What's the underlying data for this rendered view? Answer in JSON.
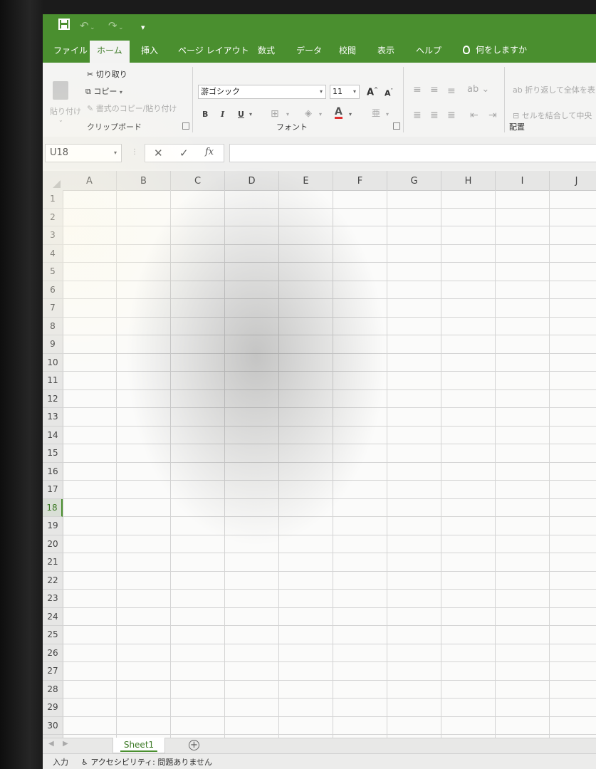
{
  "quick_access": {
    "save_icon": "save-icon",
    "undo_icon": "undo-icon",
    "redo_icon": "redo-icon",
    "customize_icon": "customize-qat-icon"
  },
  "tabs": [
    {
      "label": "ファイル",
      "active": false
    },
    {
      "label": "ホーム",
      "active": true
    },
    {
      "label": "挿入",
      "active": false
    },
    {
      "label": "ページ レイアウト",
      "active": false
    },
    {
      "label": "数式",
      "active": false
    },
    {
      "label": "データ",
      "active": false
    },
    {
      "label": "校閲",
      "active": false
    },
    {
      "label": "表示",
      "active": false
    },
    {
      "label": "ヘルプ",
      "active": false
    }
  ],
  "tell_me": "何をしますか",
  "ribbon": {
    "clipboard": {
      "paste": "貼り付け",
      "cut": "切り取り",
      "copy": "コピー",
      "format_painter": "書式のコピー/貼り付け",
      "group_label": "クリップボード"
    },
    "font": {
      "font_name": "游ゴシック",
      "font_size": "11",
      "grow": "A",
      "shrink": "A",
      "bold": "B",
      "italic": "I",
      "underline": "U",
      "group_label": "フォント",
      "font_color": "#e03030"
    },
    "alignment": {
      "wrap_text": "折り返して全体を表",
      "merge_center": "セルを結合して中央",
      "group_label": "配置"
    }
  },
  "formula_bar": {
    "name_box": "U18",
    "cancel": "✕",
    "enter": "✓",
    "fx": "fx",
    "formula": ""
  },
  "grid": {
    "columns": [
      "A",
      "B",
      "C",
      "D",
      "E",
      "F",
      "G",
      "H",
      "I",
      "J"
    ],
    "rows": [
      "1",
      "2",
      "3",
      "4",
      "5",
      "6",
      "7",
      "8",
      "9",
      "10",
      "11",
      "12",
      "13",
      "14",
      "15",
      "16",
      "17",
      "18",
      "19",
      "20",
      "21",
      "22",
      "23",
      "24",
      "25",
      "26",
      "27",
      "28",
      "29",
      "30"
    ],
    "selected_row": "18"
  },
  "sheets": {
    "tabs": [
      "Sheet1"
    ],
    "add": "+"
  },
  "status_bar": {
    "mode": "入力",
    "accessibility": "アクセシビリティ: 問題ありません"
  },
  "colors": {
    "accent": "#4a8f2f"
  }
}
